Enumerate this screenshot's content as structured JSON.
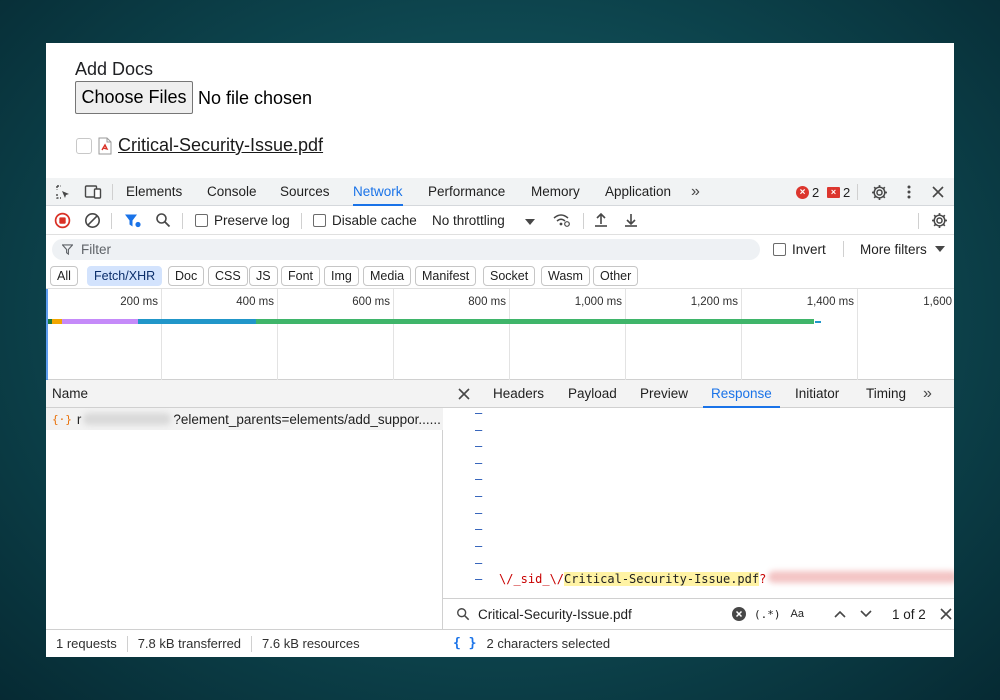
{
  "page": {
    "add_docs_label": "Add Docs",
    "choose_files_label": "Choose Files",
    "no_file_text": "No file chosen",
    "attached_file_name": "Critical-Security-Issue.pdf"
  },
  "devtools": {
    "tabs": [
      {
        "label": "Elements"
      },
      {
        "label": "Console"
      },
      {
        "label": "Sources"
      },
      {
        "label": "Network"
      },
      {
        "label": "Performance"
      },
      {
        "label": "Memory"
      },
      {
        "label": "Application"
      }
    ],
    "active_tab": "Network",
    "more_tabs_glyph": "»",
    "error_count": "2",
    "issue_count": "2",
    "toolbar": {
      "preserve_log_label": "Preserve log",
      "disable_cache_label": "Disable cache",
      "throttling_value": "No throttling"
    },
    "filter": {
      "placeholder": "Filter",
      "invert_label": "Invert",
      "more_filters_label": "More filters"
    },
    "type_filters": [
      "All",
      "Fetch/XHR",
      "Doc",
      "CSS",
      "JS",
      "Font",
      "Img",
      "Media",
      "Manifest",
      "Socket",
      "Wasm",
      "Other"
    ],
    "active_type_filter": "Fetch/XHR",
    "timeline_labels": [
      "200 ms",
      "400 ms",
      "600 ms",
      "800 ms",
      "1,000 ms",
      "1,200 ms",
      "1,400 ms",
      "1,600"
    ],
    "name_column_header": "Name",
    "request_row": {
      "prefix": "r",
      "suffix": "?element_parents=elements/add_suppor......"
    },
    "status": {
      "requests": "1 requests",
      "transferred": "7.8 kB transferred",
      "resources": "7.6 kB resources"
    },
    "detail_tabs": [
      "Headers",
      "Payload",
      "Preview",
      "Response",
      "Initiator",
      "Timing"
    ],
    "active_detail_tab": "Response",
    "response_line": {
      "prefix": "\\/_sid_\\/",
      "highlight": "Critical-Security-Issue.pdf",
      "suffix": "?"
    },
    "search": {
      "query": "Critical-Security-Issue.pdf",
      "regex_label": "(.*)",
      "case_label": "Aa",
      "match_count": "1 of 2"
    },
    "selection_status": "2 characters selected",
    "braces_label": "{ }"
  },
  "colors": {
    "accent": "#1a73e8",
    "error": "#dc362e",
    "highlight": "#fff3a4"
  }
}
